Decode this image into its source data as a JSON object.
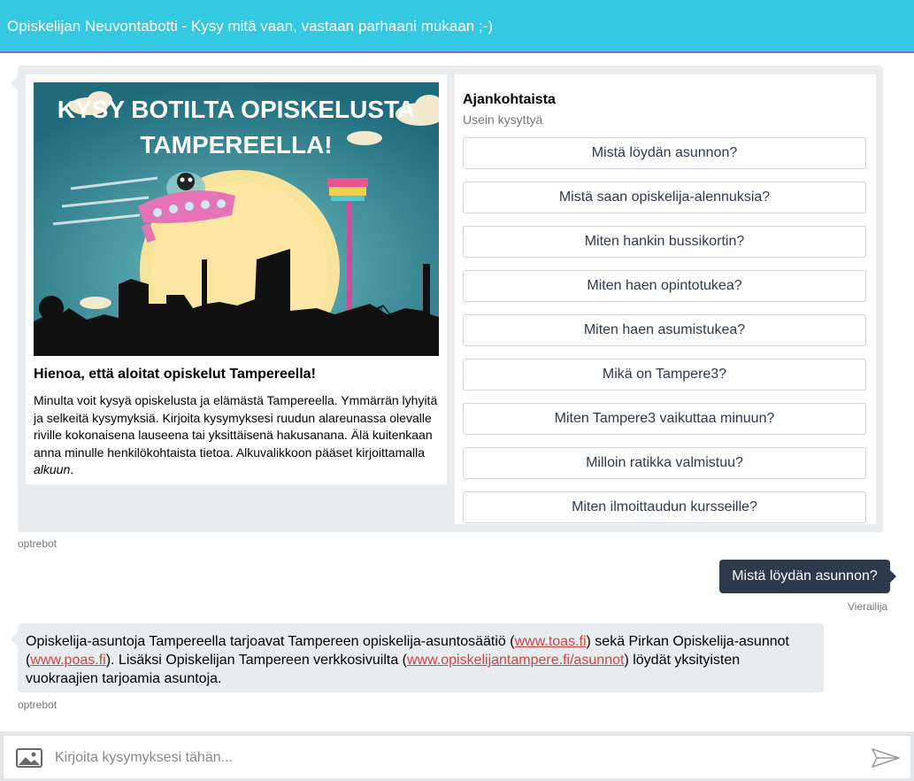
{
  "header": {
    "title": "Opiskelijan Neuvontabotti - Kysy mitä vaan, vastaan parhaani mukaan ;-)"
  },
  "welcome": {
    "hero_line1": "KYSY BOTILTA OPISKELUSTA",
    "hero_line2": "TAMPEREELLA!",
    "title": "Hienoa, että aloitat opiskelut Tampereella!",
    "text": "Minulta voit kysyä opiskelusta ja elämästä Tampereella. Ymmärrän lyhyitä ja selkeitä kysymyksiä. Kirjoita kysymyksesi ruudun alareunassa olevalle riville kokonaisena lauseena tai yksittäisenä hakusanana. Älä kuitenkaan anna minulle henkilökohtaista tietoa. Alkuvalikkoon pääset kirjoittamalla ",
    "text_em": "alkuun",
    "text_end": "."
  },
  "faq": {
    "title": "Ajankohtaista",
    "subtitle": "Usein kysyttyä",
    "items": [
      "Mistä löydän asunnon?",
      "Mistä saan opiskelija-alennuksia?",
      "Miten hankin bussikortin?",
      "Miten haen opintotukea?",
      "Miten haen asumistukea?",
      "Mikä on Tampere3?",
      "Miten Tampere3 vaikuttaa minuun?",
      "Milloin ratikka valmistuu?",
      "Miten ilmoittaudun kursseille?"
    ]
  },
  "messages": {
    "bot_sender": "optrebot",
    "user_sender": "Vierailija",
    "user_message": "Mistä löydän asunnon?",
    "bot_reply": {
      "p1": "Opiskelija-asuntoja Tampereella tarjoavat Tampereen opiskelija-asuntosäätiö (",
      "link1": "www.toas.fi",
      "p2": ") sekä Pirkan Opiskelija-asunnot (",
      "link2": "www.poas.fi",
      "p3": "). Lisäksi Opiskelijan Tampereen verkkosivuilta (",
      "link3": "www.opiskelijantampere.fi/asunnot",
      "p4": ") löydät yksityisten vuokraajien tarjoamia asuntoja."
    }
  },
  "input": {
    "placeholder": "Kirjoita kysymyksesi tähän..."
  },
  "colors": {
    "header": "#35c9e1",
    "header_border": "#8f66d6",
    "user_bubble": "#2b3a4c",
    "link": "#d0463f"
  }
}
